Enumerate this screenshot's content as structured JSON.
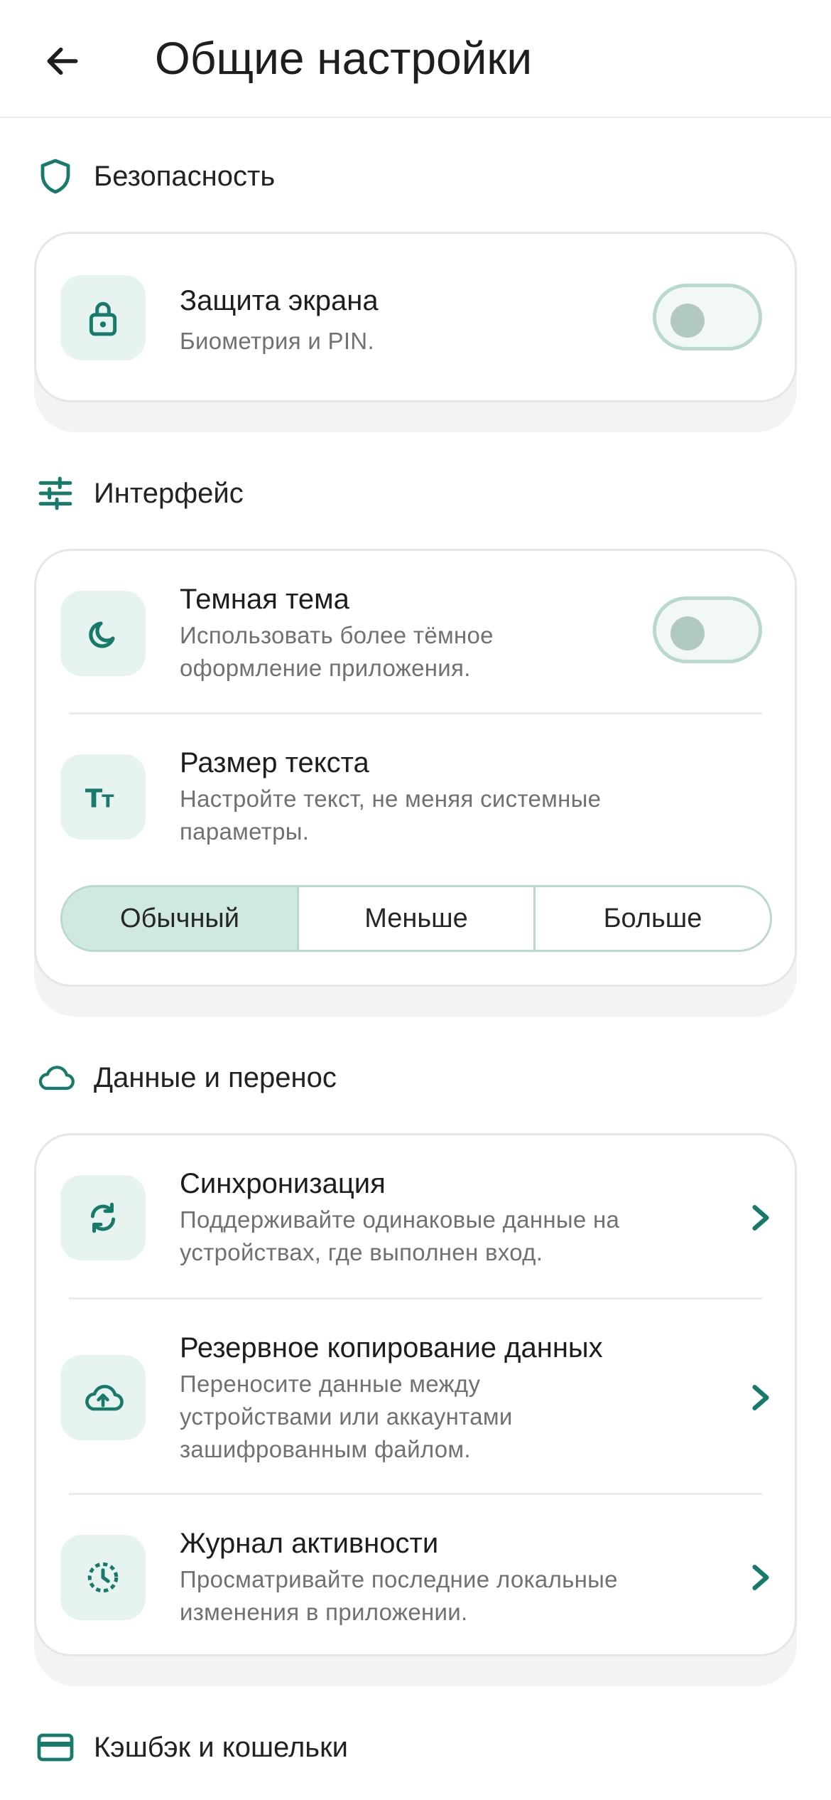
{
  "header": {
    "title": "Общие настройки",
    "back_icon": "arrow-left-icon"
  },
  "colors": {
    "accent": "#177a6a",
    "tile_bg": "#e7f3f0",
    "toggle_border": "#b9d8d0",
    "segment_active": "#cfe8e1"
  },
  "sections": {
    "security": {
      "label": "Безопасность",
      "icon": "shield-icon",
      "items": [
        {
          "title": "Защита экрана",
          "subtitle": "Биометрия и PIN.",
          "icon": "lock-icon",
          "toggle_on": false
        }
      ]
    },
    "interface": {
      "label": "Интерфейс",
      "icon": "sliders-icon",
      "dark_theme": {
        "title": "Темная тема",
        "subtitle_1": "Использовать более тёмное",
        "subtitle_2": "оформление приложения.",
        "icon": "moon-icon",
        "toggle_on": false
      },
      "text_size": {
        "title": "Размер текста",
        "subtitle_1": "Настройте текст, не меняя системные",
        "subtitle_2": "параметры.",
        "icon": "text-size-icon",
        "options": [
          "Обычный",
          "Меньше",
          "Больше"
        ],
        "selected": "Обычный"
      }
    },
    "data": {
      "label": "Данные и перенос",
      "icon": "cloud-icon",
      "sync": {
        "title": "Синхронизация",
        "subtitle_1": "Поддерживайте одинаковые данные на",
        "subtitle_2": "устройствах, где выполнен вход.",
        "icon": "sync-icon"
      },
      "backup": {
        "title": "Резервное копирование данных",
        "subtitle_1": "Переносите данные между",
        "subtitle_2": "устройствами или аккаунтами",
        "subtitle_3": "зашифрованным файлом.",
        "icon": "cloud-upload-icon"
      },
      "activity": {
        "title": "Журнал активности",
        "subtitle_1": "Просматривайте последние локальные",
        "subtitle_2": "изменения в приложении.",
        "icon": "history-icon"
      }
    },
    "cashback": {
      "label": "Кэшбэк и кошельки",
      "icon": "card-icon"
    }
  }
}
